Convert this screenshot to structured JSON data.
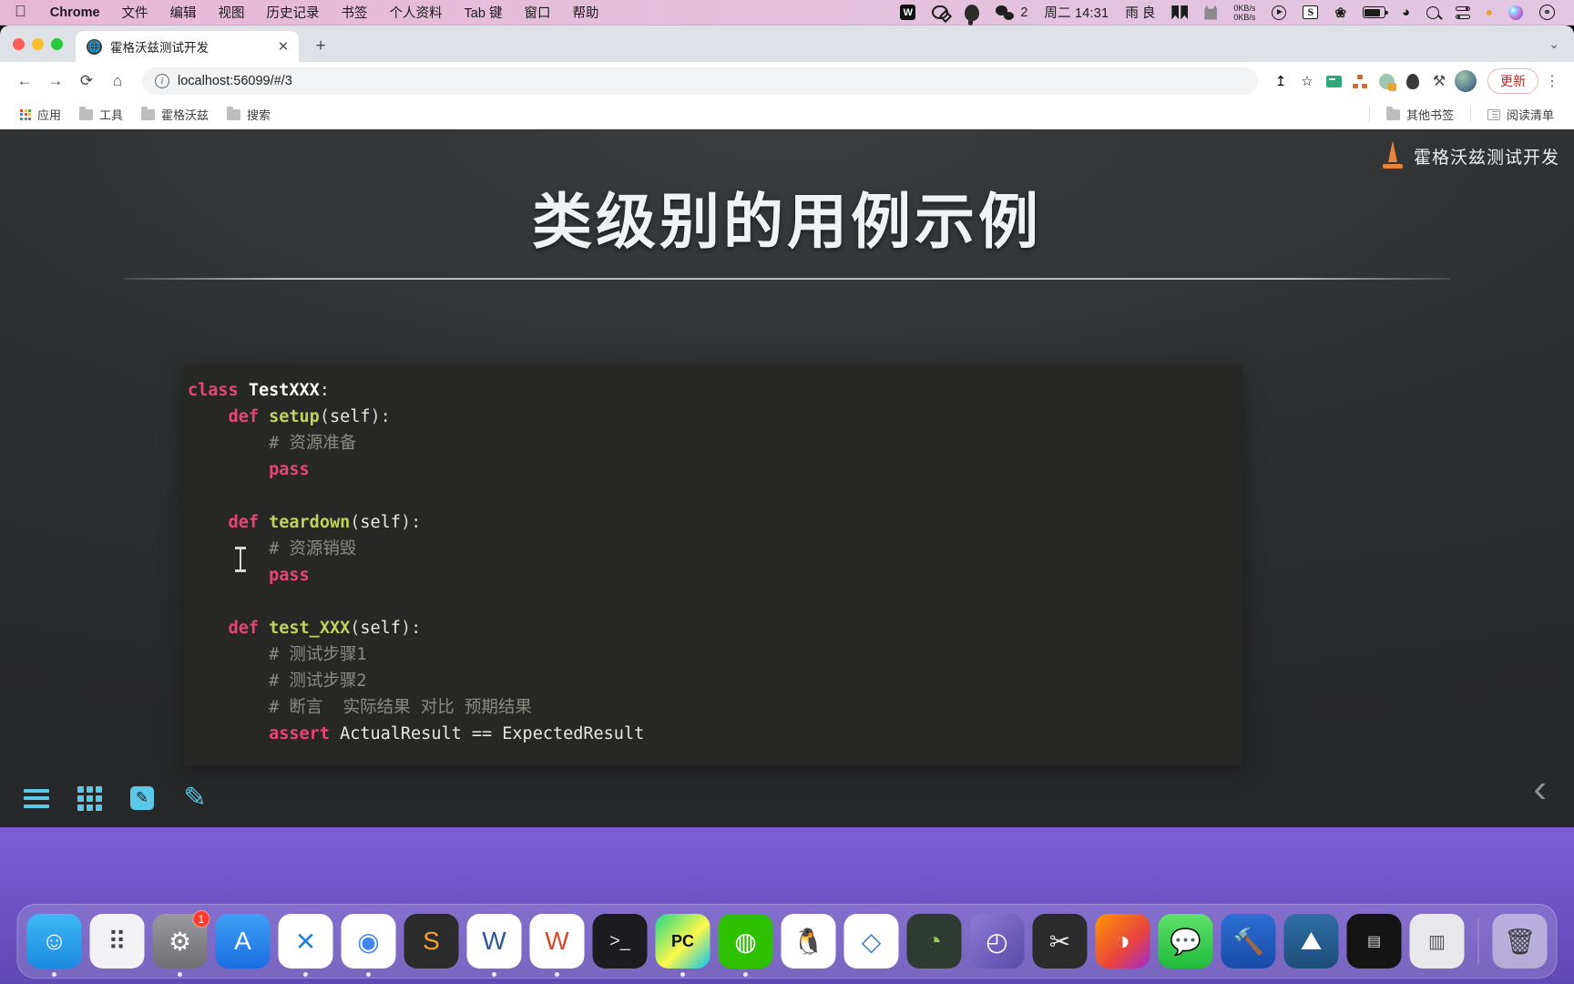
{
  "menubar": {
    "apple_icon": "apple-logo",
    "app_name": "Chrome",
    "items": [
      "文件",
      "编辑",
      "视图",
      "历史记录",
      "书签",
      "个人资料",
      "Tab 键",
      "窗口",
      "帮助"
    ],
    "status": {
      "wps_label": "W",
      "wechat_badge": "2",
      "clock": "周二 14:31",
      "weather": "雨 良",
      "net_up": "0KB/s",
      "net_down": "0KB/s",
      "sogou_label": "S"
    }
  },
  "browser": {
    "tab": {
      "title": "霍格沃兹测试开发",
      "close_label": "✕"
    },
    "new_tab_label": "+",
    "tabstrip_chevron": "⌄",
    "toolbar": {
      "back": "←",
      "forward": "→",
      "reload": "⟳",
      "home": "⌂",
      "url_display": "localhost:56099/#/3",
      "url_host": "localhost",
      "url_path": ":56099/#/3",
      "share": "↥",
      "bookmark_star": "☆",
      "update_label": "更新",
      "menu_label": "⋮"
    },
    "bookmarks": [
      {
        "label": "应用",
        "icon": "apps-grid-icon"
      },
      {
        "label": "工具",
        "icon": "folder-icon"
      },
      {
        "label": "霍格沃兹",
        "icon": "folder-icon"
      },
      {
        "label": "搜索",
        "icon": "folder-icon"
      }
    ],
    "bookmarks_right": [
      {
        "label": "其他书签",
        "icon": "folder-icon"
      },
      {
        "label": "阅读清单",
        "icon": "reading-list-icon"
      }
    ]
  },
  "slide": {
    "brand_text": "霍格沃兹测试开发",
    "title": "类级别的用例示例",
    "code_lines": [
      [
        {
          "t": "class ",
          "c": "kw"
        },
        {
          "t": "TestXXX",
          "c": "cls"
        },
        {
          "t": ":",
          "c": "op"
        }
      ],
      [
        {
          "t": "    ",
          "c": "op"
        },
        {
          "t": "def ",
          "c": "kw"
        },
        {
          "t": "setup",
          "c": "fn"
        },
        {
          "t": "(",
          "c": "pn"
        },
        {
          "t": "self",
          "c": "id"
        },
        {
          "t": "):",
          "c": "pn"
        }
      ],
      [
        {
          "t": "        # 资源准备",
          "c": "cm"
        }
      ],
      [
        {
          "t": "        ",
          "c": "op"
        },
        {
          "t": "pass",
          "c": "kw"
        }
      ],
      [
        {
          "t": "",
          "c": "op"
        }
      ],
      [
        {
          "t": "    ",
          "c": "op"
        },
        {
          "t": "def ",
          "c": "kw"
        },
        {
          "t": "teardown",
          "c": "fn"
        },
        {
          "t": "(",
          "c": "pn"
        },
        {
          "t": "self",
          "c": "id"
        },
        {
          "t": "):",
          "c": "pn"
        }
      ],
      [
        {
          "t": "        # 资源销毁",
          "c": "cm"
        }
      ],
      [
        {
          "t": "        ",
          "c": "op"
        },
        {
          "t": "pass",
          "c": "kw"
        }
      ],
      [
        {
          "t": "",
          "c": "op"
        }
      ],
      [
        {
          "t": "    ",
          "c": "op"
        },
        {
          "t": "def ",
          "c": "kw"
        },
        {
          "t": "test_XXX",
          "c": "fn"
        },
        {
          "t": "(",
          "c": "pn"
        },
        {
          "t": "self",
          "c": "id"
        },
        {
          "t": "):",
          "c": "pn"
        }
      ],
      [
        {
          "t": "        # 测试步骤1",
          "c": "cm"
        }
      ],
      [
        {
          "t": "        # 测试步骤2",
          "c": "cm"
        }
      ],
      [
        {
          "t": "        # 断言  实际结果 对比 预期结果",
          "c": "cm"
        }
      ],
      [
        {
          "t": "        ",
          "c": "op"
        },
        {
          "t": "assert",
          "c": "kw"
        },
        {
          "t": " ActualResult == ExpectedResult",
          "c": "id"
        }
      ]
    ],
    "toolbar_icons": [
      "menu-icon",
      "grid-icon",
      "pen-box-icon",
      "pencil-icon"
    ],
    "nav_prev": "‹",
    "accent_color": "#5bc8e8"
  },
  "dock": {
    "items": [
      {
        "name": "finder",
        "glyph": "☺",
        "running": true,
        "badge": ""
      },
      {
        "name": "launchpad",
        "glyph": "⠿",
        "running": false,
        "badge": ""
      },
      {
        "name": "system-settings",
        "glyph": "⚙",
        "running": true,
        "badge": "1"
      },
      {
        "name": "app-store",
        "glyph": "A",
        "running": false,
        "badge": ""
      },
      {
        "name": "vs-code",
        "glyph": "✕",
        "running": true,
        "badge": ""
      },
      {
        "name": "google-chrome",
        "glyph": "◉",
        "running": true,
        "badge": ""
      },
      {
        "name": "sublime-text",
        "glyph": "S",
        "running": false,
        "badge": ""
      },
      {
        "name": "microsoft-word",
        "glyph": "W",
        "running": true,
        "badge": ""
      },
      {
        "name": "wps-office",
        "glyph": "W",
        "running": true,
        "badge": ""
      },
      {
        "name": "terminal",
        "glyph": ">_",
        "running": false,
        "badge": ""
      },
      {
        "name": "pycharm",
        "glyph": "PC",
        "running": true,
        "badge": ""
      },
      {
        "name": "wechat",
        "glyph": "◍",
        "running": true,
        "badge": ""
      },
      {
        "name": "qq",
        "glyph": "🐧",
        "running": false,
        "badge": ""
      },
      {
        "name": "charles-proxy",
        "glyph": "◇",
        "running": false,
        "badge": ""
      },
      {
        "name": "evernote",
        "glyph": "◔",
        "running": false,
        "badge": ""
      },
      {
        "name": "time-machine",
        "glyph": "◴",
        "running": false,
        "badge": ""
      },
      {
        "name": "final-cut",
        "glyph": "✂",
        "running": false,
        "badge": ""
      },
      {
        "name": "firefox",
        "glyph": "◑",
        "running": false,
        "badge": ""
      },
      {
        "name": "messages",
        "glyph": "💬",
        "running": false,
        "badge": ""
      },
      {
        "name": "xcode",
        "glyph": "🔨",
        "running": false,
        "badge": ""
      },
      {
        "name": "mind-node",
        "glyph": "⛰",
        "running": false,
        "badge": ""
      },
      {
        "name": "iterm",
        "glyph": "▤",
        "running": false,
        "badge": ""
      },
      {
        "name": "downloads-stack",
        "glyph": "▥",
        "running": false,
        "badge": ""
      },
      {
        "name": "trash",
        "glyph": "🗑",
        "running": false,
        "badge": ""
      }
    ]
  }
}
